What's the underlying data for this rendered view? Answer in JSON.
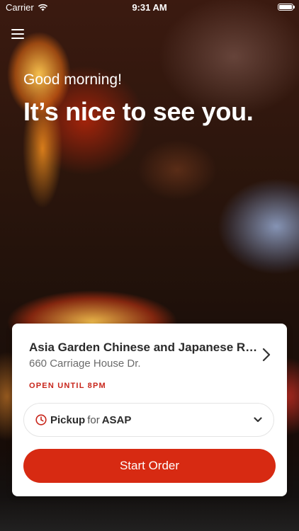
{
  "status_bar": {
    "carrier": "Carrier",
    "time": "9:31 AM"
  },
  "header": {
    "menu_icon": "hamburger-menu-icon"
  },
  "hero": {
    "greeting": "Good morning!",
    "headline": "It’s nice to see you."
  },
  "restaurant_card": {
    "name": "Asia Garden Chinese and Japanese Restaurant",
    "address": "660 Carriage House Dr.",
    "status": "OPEN UNTIL 8PM",
    "order_type": {
      "mode": "Pickup",
      "connector": "for",
      "when": "ASAP"
    },
    "cta_label": "Start Order"
  },
  "colors": {
    "accent": "#d72a12",
    "status_red": "#c8261b"
  }
}
